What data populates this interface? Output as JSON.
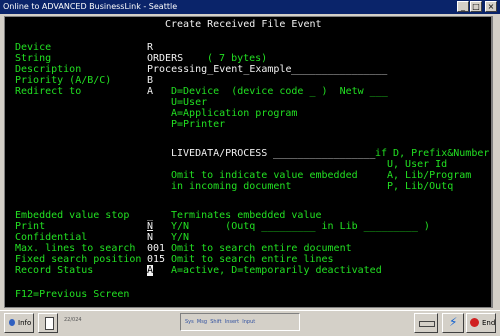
{
  "window": {
    "title": "Online to ADVANCED BusinessLink - Seattle"
  },
  "screen": {
    "title": "Create Received File Event",
    "labels": {
      "device": "Device",
      "string": "String",
      "description": "Description",
      "priority": "Priority (A/B/C)",
      "redirect": "Redirect to",
      "embedded_stop": "Embedded value stop",
      "print": "Print",
      "confidential": "Confidential",
      "max_lines": "Max. lines to search",
      "fixed_pos": "Fixed search position",
      "record_status": "Record Status"
    },
    "values": {
      "device": "R",
      "string": "ORDERS",
      "string_bytes": "( 7 bytes)",
      "description": "Processing_Event_Example",
      "priority": "B",
      "redirect": "A",
      "livedata": "LIVEDATA/PROCESS",
      "embedded_stop": "_",
      "print": "N",
      "confidential": "N",
      "max_lines": "001",
      "fixed_pos": "015",
      "record_status": "A"
    },
    "redirect_options": {
      "device": "D=Device  (device code _ )  Netw ___",
      "user": "U=User",
      "application": "A=Application program",
      "printer": "P=Printer"
    },
    "livedata_hint1": "if D, Prefix&Number",
    "livedata_hint2": "U, User Id",
    "omit1": "Omit to indicate value embedded",
    "omit2": "in incoming document",
    "omit_hint1": "A, Lib/Program",
    "omit_hint2": "P, Lib/Outq",
    "embedded_stop_hint": "Terminates embedded value",
    "print_hint": "Y/N      (Outq _________ in Lib _________ )",
    "confidential_hint": "Y/N",
    "max_lines_hint": "Omit to search entire document",
    "fixed_pos_hint": "Omit to search entire lines",
    "record_status_hint": "A=active, D=temporarily deactivated",
    "fkeys": "F12=Previous Screen"
  },
  "statusbar": {
    "info_label": "Info",
    "position": "22/024",
    "indicators": "Sys  Msg  Shift  Insert  Input",
    "end_label": "End"
  }
}
